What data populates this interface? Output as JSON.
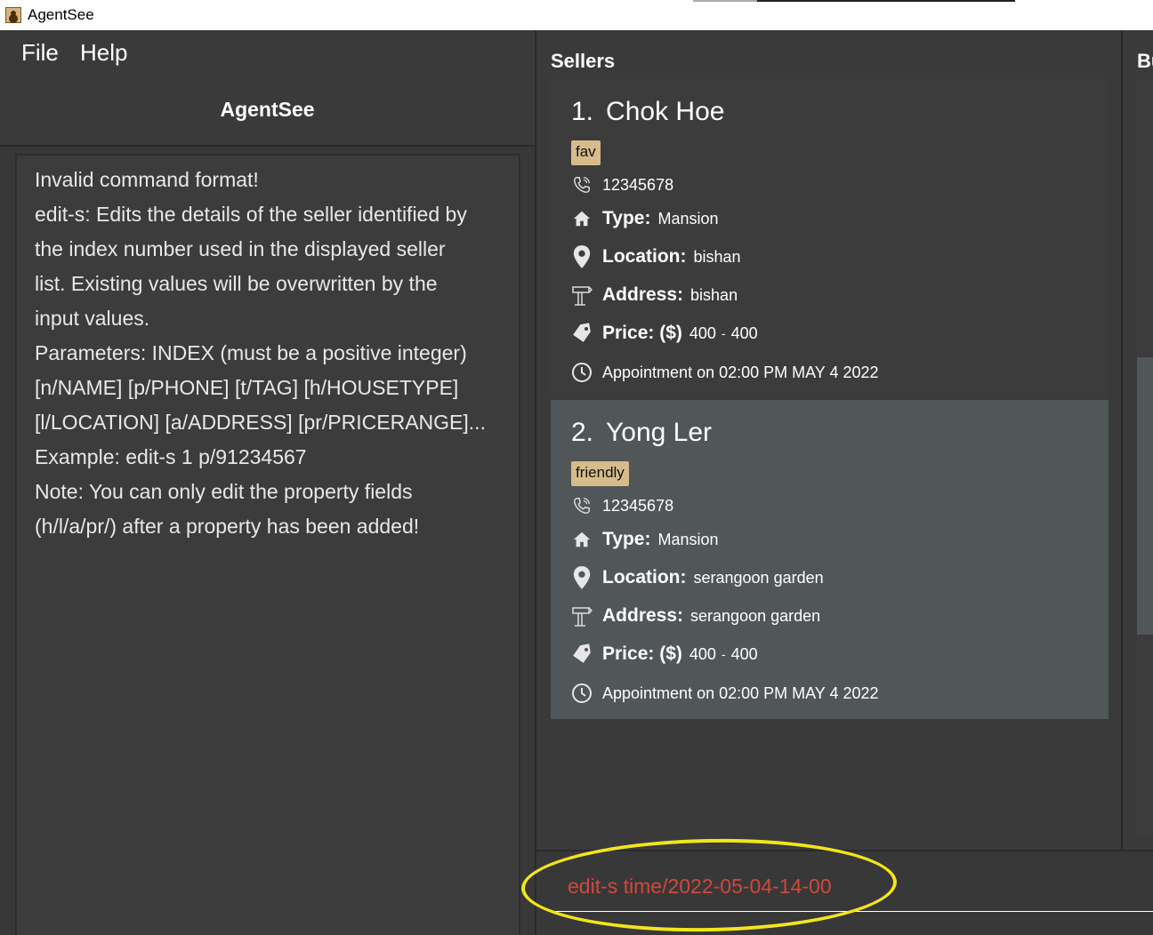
{
  "window": {
    "title": "AgentSee"
  },
  "menu": {
    "file": "File",
    "help": "Help"
  },
  "app_heading": "AgentSee",
  "result_lines": [
    "Invalid command format!",
    "edit-s: Edits the details of the seller identified by",
    "the index number used in the displayed seller",
    "list. Existing values will be overwritten by the",
    "input values.",
    "Parameters: INDEX (must be a positive integer)",
    "[n/NAME] [p/PHONE] [t/TAG] [h/HOUSETYPE]",
    "[l/LOCATION] [a/ADDRESS] [pr/PRICERANGE]...",
    "Example: edit-s 1 p/91234567",
    "Note: You can only edit the property fields",
    "(h/l/a/pr/) after a property has been added!"
  ],
  "sellers": {
    "title": "Sellers",
    "labels": {
      "type": "Type:",
      "location": "Location:",
      "address": "Address:",
      "price": "Price: ($)",
      "dash": "-"
    },
    "items": [
      {
        "index": "1.",
        "name": "Chok Hoe",
        "tag": "fav",
        "phone": "12345678",
        "type": "Mansion",
        "location": "bishan",
        "address": "bishan",
        "price_min": "400",
        "price_max": "400",
        "appointment": "Appointment on 02:00 PM MAY 4 2022"
      },
      {
        "index": "2.",
        "name": "Yong Ler",
        "tag": "friendly",
        "phone": "12345678",
        "type": "Mansion",
        "location": "serangoon garden",
        "address": "serangoon garden",
        "price_min": "400",
        "price_max": "400",
        "appointment": "Appointment on 02:00 PM MAY 4 2022"
      }
    ]
  },
  "buyers": {
    "title_visible": "Bu"
  },
  "command": {
    "value": "edit-s time/2022-05-04-14-00"
  },
  "colors": {
    "command_text": "#d0493a",
    "tag_bg": "#d6bc8a",
    "highlight": "#f2e51c",
    "selected_card": "#515658"
  }
}
